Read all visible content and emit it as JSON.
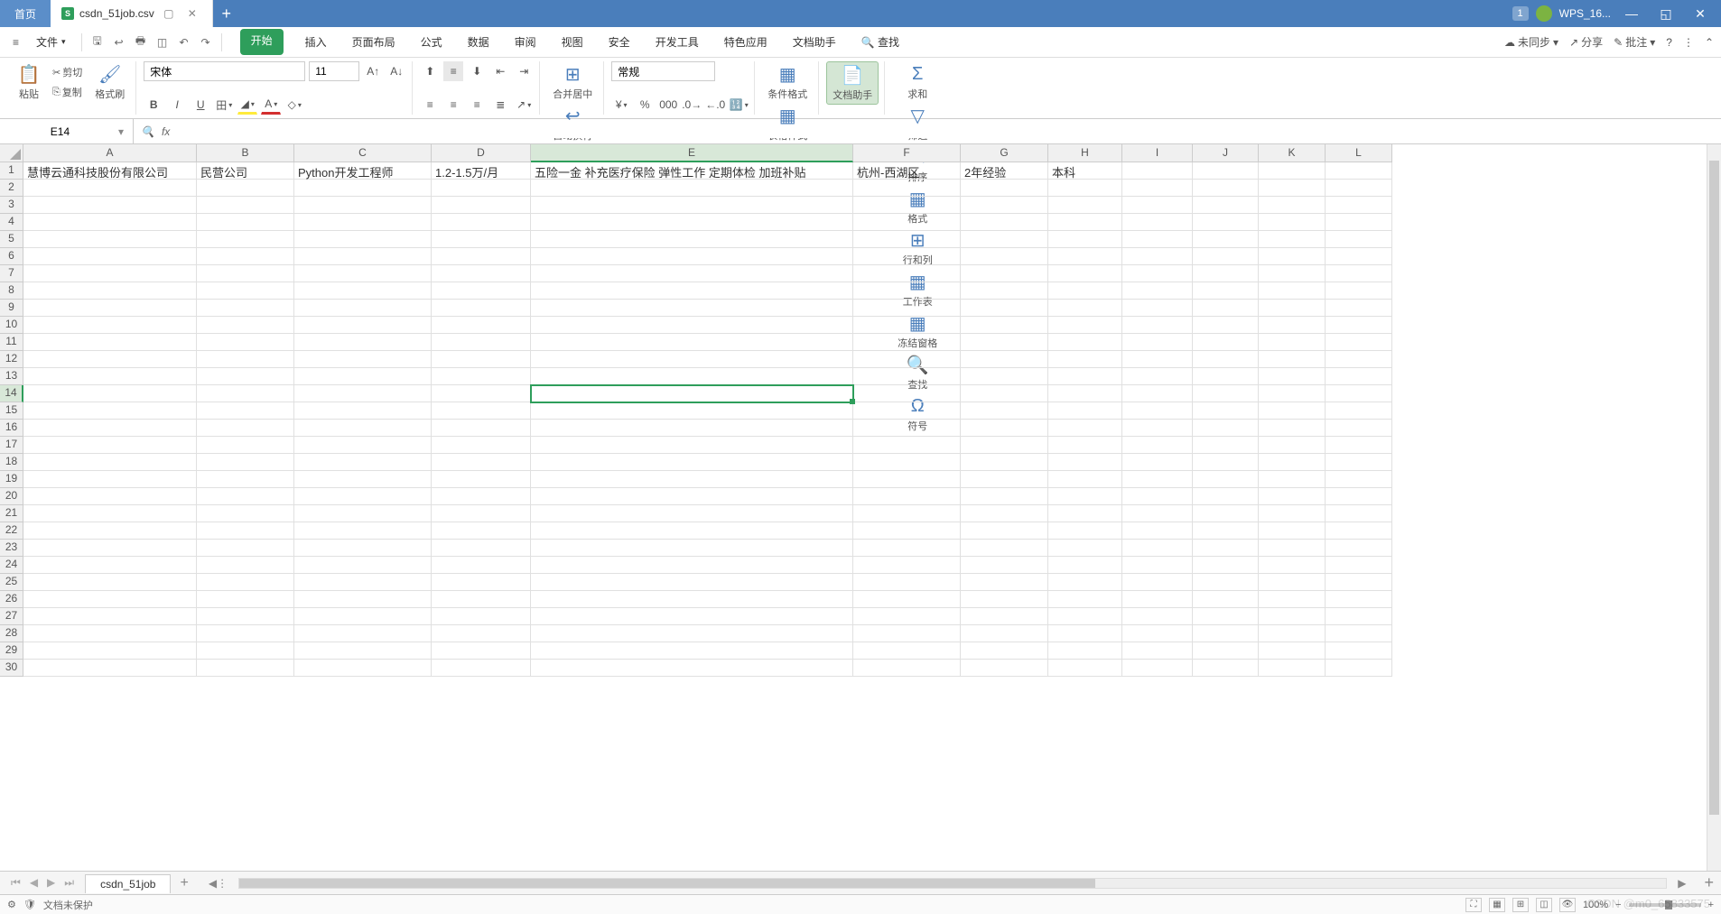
{
  "titlebar": {
    "home_tab": "首页",
    "file_tab": "csdn_51job.csv",
    "file_badge": "S",
    "badge_count": "1",
    "wps_label": "WPS_16..."
  },
  "menubar": {
    "file": "文件",
    "tabs": [
      "开始",
      "插入",
      "页面布局",
      "公式",
      "数据",
      "审阅",
      "视图",
      "安全",
      "开发工具",
      "特色应用",
      "文档助手"
    ],
    "search": "查找",
    "unsync": "未同步",
    "share": "分享",
    "annotate": "批注"
  },
  "ribbon": {
    "paste": "粘贴",
    "cut": "剪切",
    "copy": "复制",
    "format_painter": "格式刷",
    "font_name": "宋体",
    "font_size": "11",
    "merge_center": "合并居中",
    "auto_wrap": "自动换行",
    "number_format": "常规",
    "cond_fmt": "条件格式",
    "table_style": "表格样式",
    "doc_helper": "文档助手",
    "sum": "求和",
    "filter": "筛选",
    "sort": "排序",
    "format": "格式",
    "rowcol": "行和列",
    "worksheet": "工作表",
    "freeze": "冻结窗格",
    "find": "查找",
    "symbol": "符号"
  },
  "formula": {
    "cell_ref": "E14",
    "fx": "fx"
  },
  "columns": [
    "A",
    "B",
    "C",
    "D",
    "E",
    "F",
    "G",
    "H",
    "I",
    "J",
    "K",
    "L"
  ],
  "rows": [
    "1",
    "2",
    "3",
    "4",
    "5",
    "6",
    "7",
    "8",
    "9",
    "10",
    "11",
    "12",
    "13",
    "14",
    "15",
    "16",
    "17",
    "18",
    "19",
    "20",
    "21",
    "22",
    "23",
    "24",
    "25",
    "26",
    "27",
    "28",
    "29",
    "30"
  ],
  "data": {
    "A1": "慧博云通科技股份有限公司",
    "B1": "民营公司",
    "C1": "Python开发工程师",
    "D1": "1.2-1.5万/月",
    "E1": "五险一金 补充医疗保险 弹性工作 定期体检 加班补贴",
    "F1": "杭州-西湖区",
    "G1": "2年经验",
    "H1": "本科"
  },
  "selected_cell": "E14",
  "sheet_tabs": {
    "active": "csdn_51job"
  },
  "status": {
    "protect": "文档未保护",
    "zoom": "100%"
  },
  "watermark": "CSDN @m0_65833575"
}
